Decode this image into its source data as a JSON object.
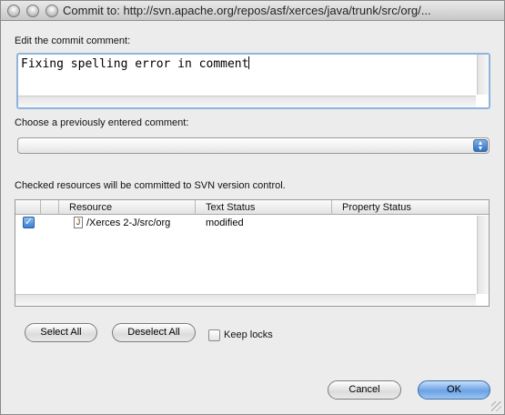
{
  "window": {
    "title": "Commit to: http://svn.apache.org/repos/asf/xerces/java/trunk/src/org/..."
  },
  "comment": {
    "label": "Edit the commit comment:",
    "value": "Fixing spelling error in comment"
  },
  "previous": {
    "label": "Choose a previously entered comment:",
    "selected": ""
  },
  "resources": {
    "label": "Checked resources will be committed to SVN version control.",
    "columns": [
      "Resource",
      "Text Status",
      "Property Status"
    ],
    "rows": [
      {
        "checked": true,
        "resource": "/Xerces 2-J/src/org",
        "text_status": "modified",
        "property_status": ""
      }
    ]
  },
  "actions": {
    "select_all": "Select All",
    "deselect_all": "Deselect All",
    "keep_locks": "Keep locks",
    "cancel": "Cancel",
    "ok": "OK"
  },
  "icons": {
    "file_icon_glyph": "J"
  },
  "colors": {
    "accent_blue": "#3b7fd1",
    "focus_ring": "#8fb4dd",
    "window_bg": "#ececec"
  }
}
